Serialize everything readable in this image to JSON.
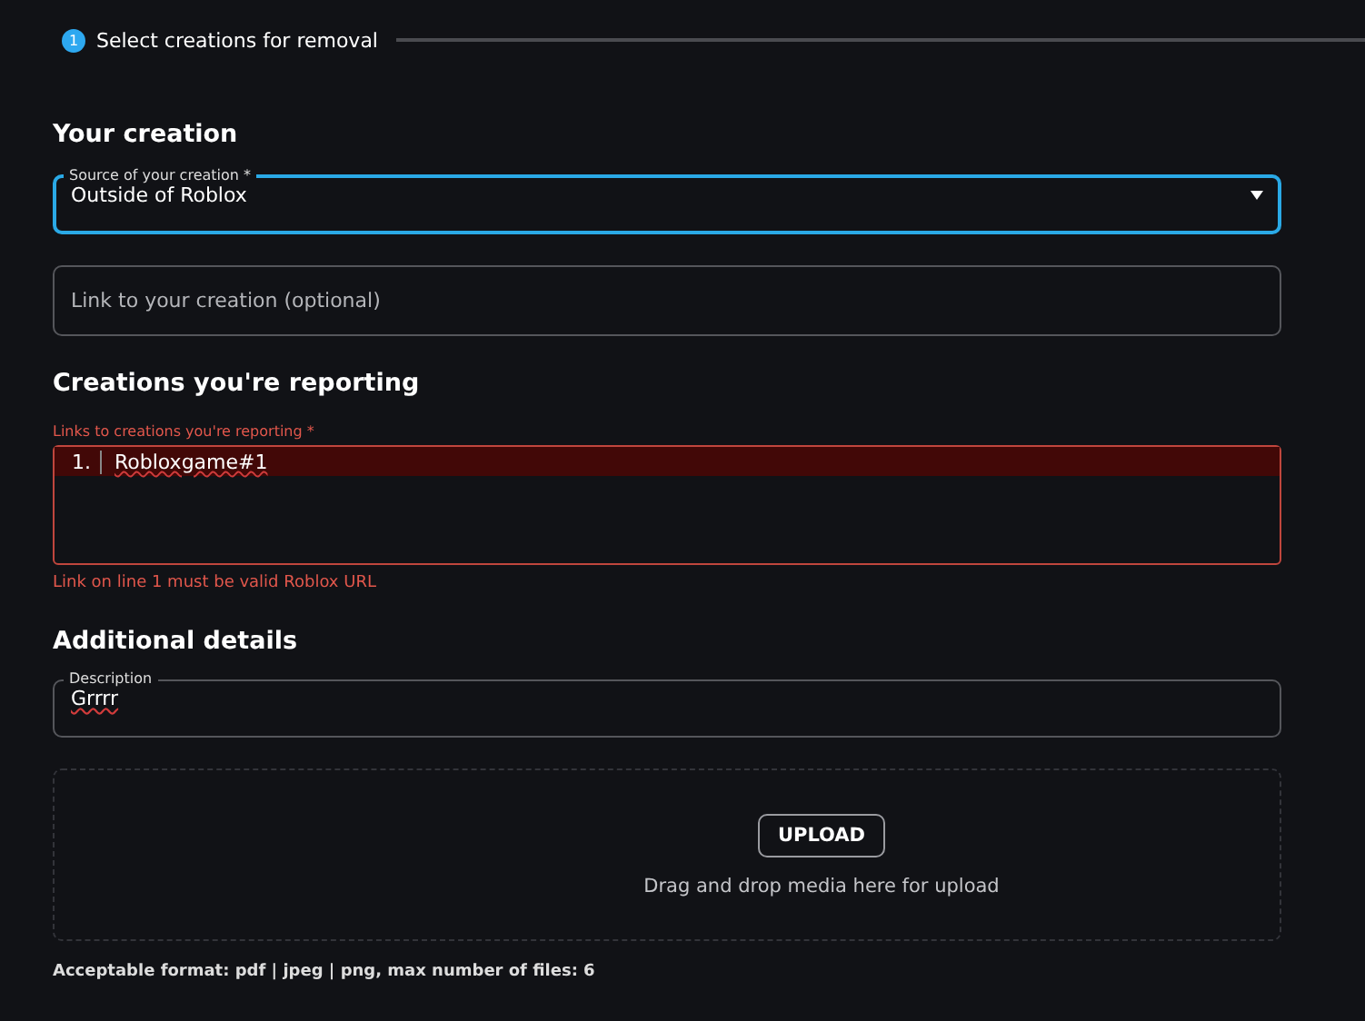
{
  "step": {
    "number": "1",
    "title": "Select creations for removal",
    "active": true
  },
  "your_creation": {
    "heading": "Your creation",
    "source": {
      "label": "Source of your creation *",
      "value": "Outside of Roblox",
      "focused": true
    },
    "link": {
      "placeholder": "Link to your creation (optional)"
    }
  },
  "reporting": {
    "heading": "Creations you're reporting",
    "label": "Links to creations you're reporting *",
    "error": true,
    "lines": [
      {
        "number": "1.",
        "text": "Robloxgame#1"
      }
    ],
    "error_message": "Link on line 1 must be valid Roblox URL"
  },
  "additional": {
    "heading": "Additional details",
    "description": {
      "label": "Description",
      "value": "Grrrr"
    },
    "upload": {
      "button": "UPLOAD",
      "hint": "Drag and drop media here for upload"
    },
    "note": "Acceptable format: pdf | jpeg | png, max number of files: 6"
  }
}
